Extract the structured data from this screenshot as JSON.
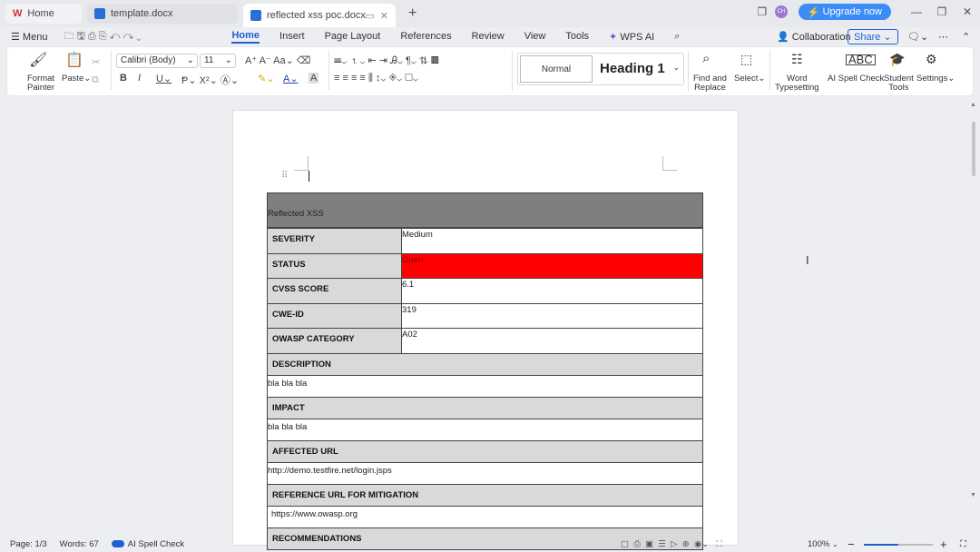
{
  "tabs": [
    {
      "label": "Home"
    },
    {
      "label": "template.docx"
    },
    {
      "label": "reflected xss poc.docx"
    }
  ],
  "titlebar": {
    "upgrade": "Upgrade now",
    "avatar": "CH"
  },
  "menu": {
    "menu_label": "Menu",
    "items": [
      "Home",
      "Insert",
      "Page Layout",
      "References",
      "Review",
      "View",
      "Tools",
      "WPS AI"
    ],
    "collaboration": "Collaboration",
    "share": "Share"
  },
  "ribbon": {
    "format_painter": "Format\nPainter",
    "paste": "Paste",
    "font": "Calibri (Body)",
    "size": "11",
    "style_normal": "Normal",
    "style_heading": "Heading 1",
    "find_replace": "Find and\nReplace",
    "select": "Select",
    "word_typesetting": "Word\nTypesetting",
    "ai_spell_check": "AI Spell Check",
    "student_tools": "Student\nTools",
    "settings": "Settings"
  },
  "document": {
    "title": "Reflected XSS",
    "rows": [
      {
        "label": "SEVERITY",
        "value": "Medium"
      },
      {
        "label": "STATUS",
        "value": "Open"
      },
      {
        "label": "CVSS SCORE",
        "value": "6.1"
      },
      {
        "label": "CWE-ID",
        "value": "319"
      },
      {
        "label": "OWASP CATEGORY",
        "value": "A02"
      }
    ],
    "sections": [
      {
        "label": "DESCRIPTION",
        "value": "bla bla bla"
      },
      {
        "label": "IMPACT",
        "value": "bla bla bla"
      },
      {
        "label": "AFFECTED URL",
        "value": "http://demo.testfire.net/login.jsps"
      },
      {
        "label": "REFERENCE URL FOR MITIGATION",
        "value": " https://www.owasp.org"
      },
      {
        "label": "RECOMMENDATIONS",
        "value": ""
      }
    ],
    "status_color": "#ff0000"
  },
  "statusbar": {
    "page": "Page: 1/3",
    "words": "Words: 67",
    "spell": "AI Spell Check",
    "zoom": "100%",
    "zoom_level": 0.5
  }
}
